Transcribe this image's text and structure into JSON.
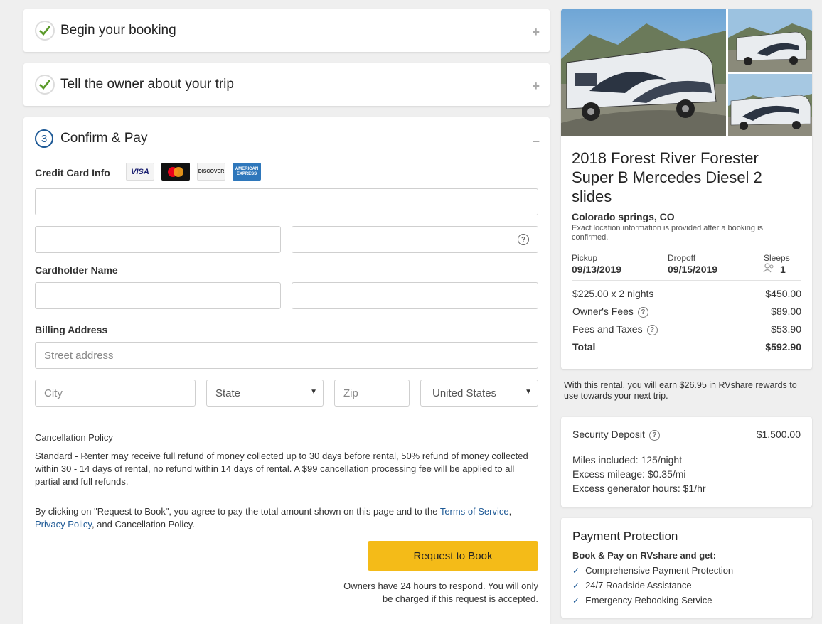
{
  "steps": {
    "step1": {
      "title": "Begin your booking",
      "toggle": "+"
    },
    "step2": {
      "title": "Tell the owner about your trip",
      "toggle": "+"
    },
    "step3": {
      "number": "3",
      "title": "Confirm & Pay",
      "toggle": "−"
    }
  },
  "payment": {
    "credit_card_label": "Credit Card Info",
    "cards": [
      "VISA",
      "MC",
      "DISCOVER",
      "AMERICAN EXPRESS"
    ],
    "cardholder_label": "Cardholder Name",
    "billing_label": "Billing Address",
    "street_placeholder": "Street address",
    "city_placeholder": "City",
    "state_value": "State",
    "zip_placeholder": "Zip",
    "country_value": "United States"
  },
  "policy": {
    "title": "Cancellation Policy",
    "text": "Standard - Renter may receive full refund of money collected up to 30 days before rental, 50% refund of money collected within 30 - 14 days of rental, no refund within 14 days of rental. A $99 cancellation processing fee will be applied to all partial and full refunds.",
    "agree_prefix": "By clicking on \"Request to Book\", you agree to pay the total amount shown on this page and to the ",
    "terms_link": "Terms of Service",
    "comma": ",",
    "privacy_link": "Privacy Policy",
    "agree_suffix": ", and Cancellation Policy."
  },
  "book_button": "Request to Book",
  "respond_note_line1": "Owners have 24 hours to respond. You will only",
  "respond_note_line2": "be charged if this request is accepted.",
  "listing": {
    "title": "2018 Forest River Forester Super B Mercedes Diesel 2 slides",
    "location": "Colorado springs, CO",
    "location_note": "Exact location information is provided after a booking is confirmed.",
    "pickup_label": "Pickup",
    "pickup_date": "09/13/2019",
    "dropoff_label": "Dropoff",
    "dropoff_date": "09/15/2019",
    "sleeps_label": "Sleeps",
    "sleeps_value": "1"
  },
  "prices": {
    "nights_label": "$225.00 x 2 nights",
    "nights_value": "$450.00",
    "owner_fees_label": "Owner's Fees",
    "owner_fees_value": "$89.00",
    "fees_taxes_label": "Fees and Taxes",
    "fees_taxes_value": "$53.90",
    "total_label": "Total",
    "total_value": "$592.90"
  },
  "rewards_line1": "With this rental, you will earn $26.95 in RVshare rewards to",
  "rewards_line2": "use towards your next trip.",
  "deposit": {
    "label": "Security Deposit",
    "value": "$1,500.00",
    "miles": "Miles included: 125/night",
    "excess_mileage": "Excess mileage: $0.35/mi",
    "excess_generator": "Excess generator hours: $1/hr"
  },
  "protection": {
    "title": "Payment Protection",
    "subtitle": "Book & Pay on RVshare and get:",
    "items": [
      "Comprehensive Payment Protection",
      "24/7 Roadside Assistance",
      "Emergency Rebooking Service"
    ]
  },
  "colors": {
    "accent_blue": "#1f5a96",
    "book_yellow": "#f4bb18",
    "check_green": "#5b9a2a"
  }
}
